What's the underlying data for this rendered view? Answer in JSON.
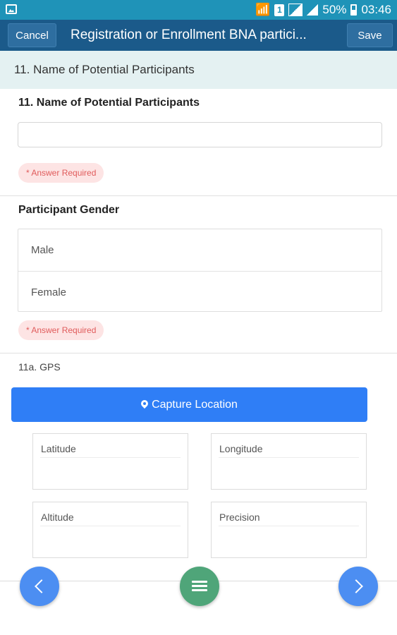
{
  "status_bar": {
    "battery": "50%",
    "time": "03:46",
    "sim_label": "1",
    "icons": [
      "image-icon",
      "wifi-icon",
      "sim-icon",
      "signal-icon",
      "signal-icon",
      "battery-icon"
    ]
  },
  "toolbar": {
    "cancel_label": "Cancel",
    "title": "Registration or Enrollment BNA partici...",
    "save_label": "Save"
  },
  "section_header": "11. Name of Potential Participants",
  "questions": {
    "name": {
      "title": "11. Name of Potential Participants",
      "value": "",
      "required_text": "* Answer Required"
    },
    "gender": {
      "title": "Participant Gender",
      "options": [
        "Male",
        "Female"
      ],
      "required_text": "* Answer Required"
    },
    "gps": {
      "label": "11a. GPS",
      "capture_label": "Capture Location",
      "fields": {
        "latitude": "Latitude",
        "longitude": "Longitude",
        "altitude": "Altitude",
        "precision": "Precision"
      }
    }
  },
  "colors": {
    "status_bar": "#1f93b8",
    "toolbar": "#1b5a8a",
    "section_header_bg": "#e4f1f2",
    "required_badge_bg": "#fde4e4",
    "required_badge_text": "#e05b5b",
    "capture_button": "#2f7ef6",
    "nav_button": "#4c8ef2",
    "menu_button": "#4fa579"
  }
}
